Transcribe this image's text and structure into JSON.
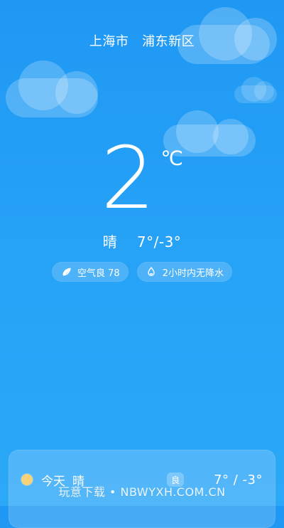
{
  "location": {
    "city": "上海市",
    "district": "浦东新区"
  },
  "current": {
    "temperature": "2",
    "unit": "℃",
    "condition": "晴",
    "range": "7°/-3°"
  },
  "pills": [
    {
      "icon": "leaf-icon",
      "label": "空气良 78"
    },
    {
      "icon": "water-drop-icon",
      "label": "2小时内无降水"
    }
  ],
  "forecast": {
    "today": {
      "day": "今天",
      "condition": "晴",
      "air_quality_badge": "良",
      "range": "7° / -3°"
    }
  },
  "watermark": "玩意下载 • NBWYXH.COM.CN",
  "colors": {
    "sky_top": "#1f98f3",
    "sky_bottom": "#2ca8f8",
    "sun": "#f6d37b"
  }
}
